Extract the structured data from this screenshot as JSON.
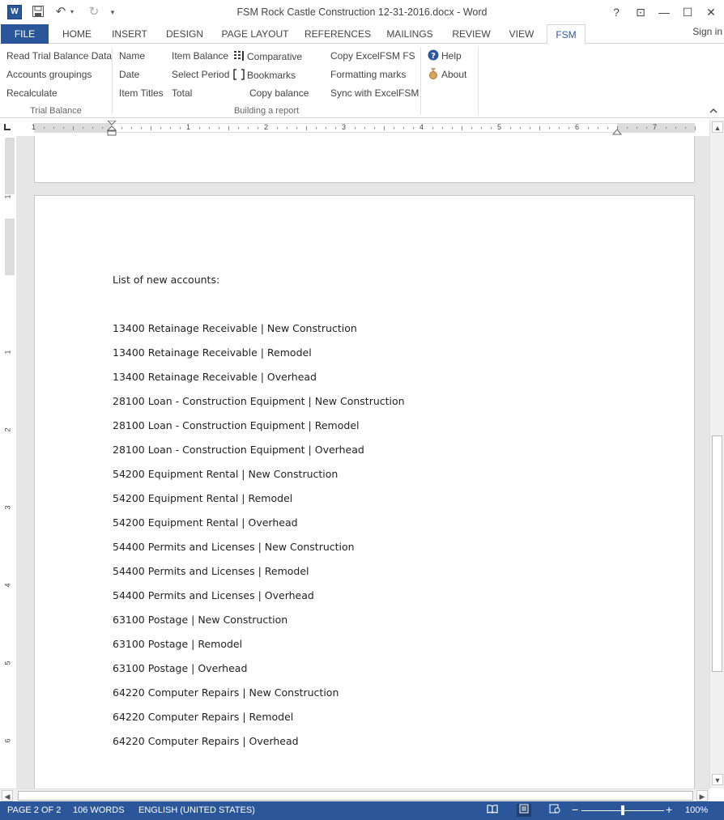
{
  "titlebar": {
    "title": "FSM Rock Castle Construction 12-31-2016.docx - Word",
    "logo": "W",
    "controls": {
      "help": "?",
      "restore_ribbon": "⊡",
      "minimize": "—",
      "maximize": "☐",
      "close": "✕"
    }
  },
  "tabs": [
    "FILE",
    "HOME",
    "INSERT",
    "DESIGN",
    "PAGE LAYOUT",
    "REFERENCES",
    "MAILINGS",
    "REVIEW",
    "VIEW",
    "FSM"
  ],
  "active_tab": "FSM",
  "signin": "Sign in",
  "ribbon": {
    "trial_balance": {
      "items": [
        "Read Trial Balance Data",
        "Accounts groupings",
        "Recalculate"
      ],
      "label": "Trial Balance"
    },
    "building_report": {
      "col1": [
        "Name",
        "Date",
        "Item Titles"
      ],
      "col2": [
        "Item Balance",
        "Select Period",
        "Total"
      ],
      "col3": [
        "Comparative",
        "Bookmarks",
        "Copy balance"
      ],
      "col4": [
        "Copy ExcelFSM FS",
        "Formatting marks",
        "Sync with ExcelFSM"
      ],
      "label": "Building a report"
    },
    "help_group": {
      "help": "Help",
      "about": "About"
    }
  },
  "ruler": {
    "h_numbers": [
      "1",
      "1",
      "2",
      "3",
      "4",
      "5",
      "6",
      "7"
    ],
    "v_numbers": [
      "1",
      "1",
      "2",
      "3",
      "4",
      "5",
      "6"
    ]
  },
  "document": {
    "heading": "List of new accounts:",
    "accounts": [
      "13400 Retainage Receivable | New Construction",
      "13400 Retainage Receivable | Remodel",
      "13400 Retainage Receivable | Overhead",
      "28100 Loan - Construction Equipment | New Construction",
      "28100 Loan - Construction Equipment | Remodel",
      "28100 Loan - Construction Equipment | Overhead",
      "54200 Equipment Rental | New Construction",
      "54200 Equipment Rental | Remodel",
      "54200 Equipment Rental | Overhead",
      "54400 Permits and Licenses | New Construction",
      "54400 Permits and Licenses | Remodel",
      "54400 Permits and Licenses | Overhead",
      "63100 Postage | New Construction",
      "63100 Postage | Remodel",
      "63100 Postage | Overhead",
      "64220 Computer Repairs | New Construction",
      "64220 Computer Repairs | Remodel",
      "64220 Computer Repairs | Overhead"
    ]
  },
  "statusbar": {
    "page": "PAGE 2 OF 2",
    "words": "106 WORDS",
    "language": "ENGLISH (UNITED STATES)",
    "zoom": "100%",
    "zoom_level": 0.5
  },
  "colors": {
    "accent": "#2b579a"
  }
}
